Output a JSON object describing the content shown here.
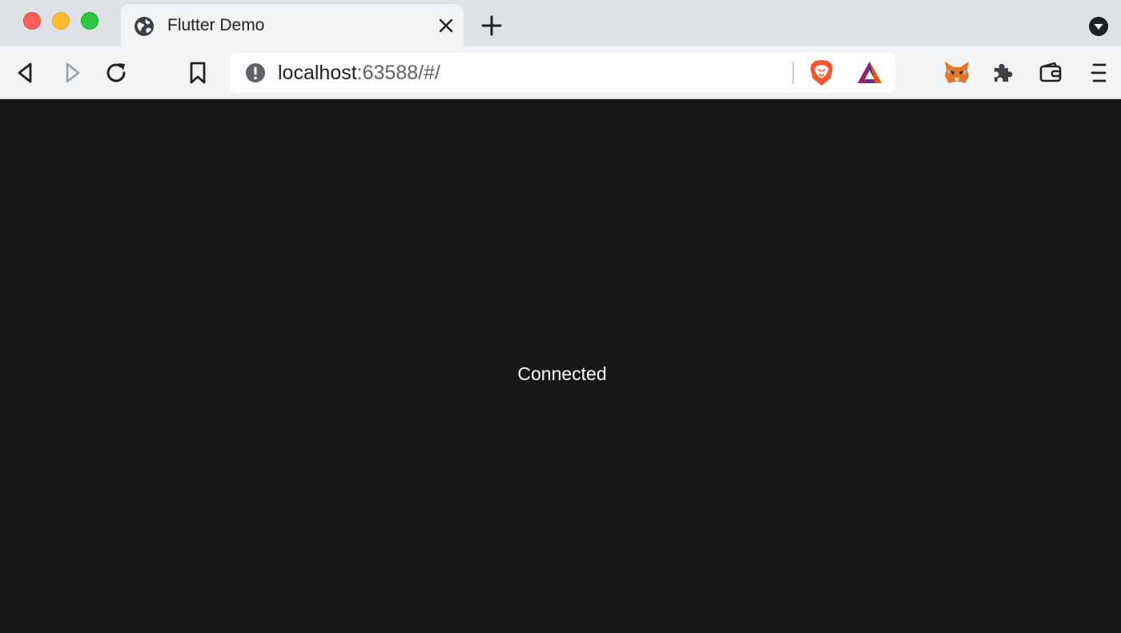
{
  "window": {
    "controls": [
      "close",
      "minimize",
      "maximize"
    ]
  },
  "tab": {
    "title": "Flutter Demo",
    "icon": "globe-icon"
  },
  "toolbar": {
    "icons": [
      "back-icon",
      "forward-icon",
      "reload-icon",
      "bookmark-icon",
      "metamask-fox-icon",
      "extensions-puzzle-icon",
      "wallet-icon",
      "menu-icon"
    ]
  },
  "address_bar": {
    "host": "localhost",
    "rest": ":63588/#/",
    "icons": [
      "info-icon",
      "brave-shields-lion-icon",
      "brave-rewards-bat-icon"
    ]
  },
  "page": {
    "status_text": "Connected"
  },
  "colors": {
    "background": "#181818",
    "tabstrip": "#dee1e6",
    "toolbar": "#f1f3f4",
    "brave_orange": "#fb542b"
  }
}
